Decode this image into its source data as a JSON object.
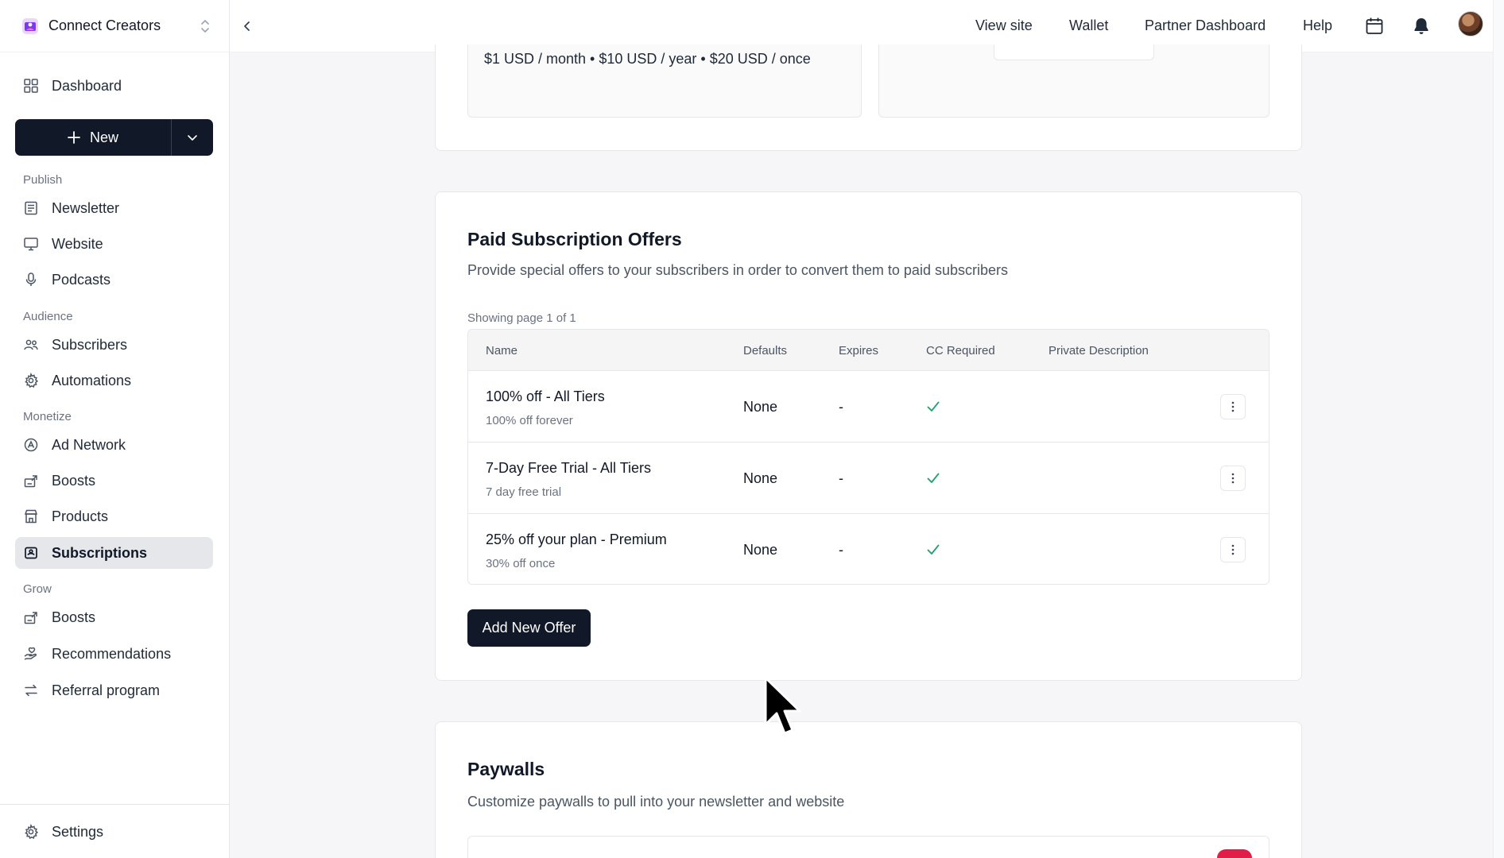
{
  "brand": {
    "name": "Connect Creators"
  },
  "topbar": {
    "links": [
      "View site",
      "Wallet",
      "Partner Dashboard",
      "Help"
    ]
  },
  "sidebar": {
    "dashboard": "Dashboard",
    "new_label": "New",
    "sections": {
      "publish": "Publish",
      "audience": "Audience",
      "monetize": "Monetize",
      "grow": "Grow"
    },
    "publish": [
      "Newsletter",
      "Website",
      "Podcasts"
    ],
    "audience": [
      "Subscribers",
      "Automations"
    ],
    "monetize": [
      "Ad Network",
      "Boosts",
      "Products",
      "Subscriptions"
    ],
    "grow": [
      "Boosts",
      "Recommendations",
      "Referral program"
    ],
    "settings": "Settings",
    "active": "Subscriptions"
  },
  "pricing": {
    "line": "$1 USD / month • $10 USD / year • $20 USD / once"
  },
  "offers": {
    "title": "Paid Subscription Offers",
    "description": "Provide special offers to your subscribers in order to convert them to paid subscribers",
    "showing": "Showing page 1 of 1",
    "columns": [
      "Name",
      "Defaults",
      "Expires",
      "CC Required",
      "Private Description"
    ],
    "rows": [
      {
        "name": "100% off - All Tiers",
        "sub": "100% off forever",
        "defaults": "None",
        "expires": "-",
        "cc_required": true
      },
      {
        "name": "7-Day Free Trial - All Tiers",
        "sub": "7 day free trial",
        "defaults": "None",
        "expires": "-",
        "cc_required": true
      },
      {
        "name": "25% off your plan - Premium",
        "sub": "30% off once",
        "defaults": "None",
        "expires": "-",
        "cc_required": true
      }
    ],
    "add_button": "Add New Offer"
  },
  "paywalls": {
    "title": "Paywalls",
    "description": "Customize paywalls to pull into your newsletter and website"
  },
  "colors": {
    "primary_dark": "#111827",
    "check_green": "#22a06b",
    "toggle_on": "#e11d48"
  }
}
